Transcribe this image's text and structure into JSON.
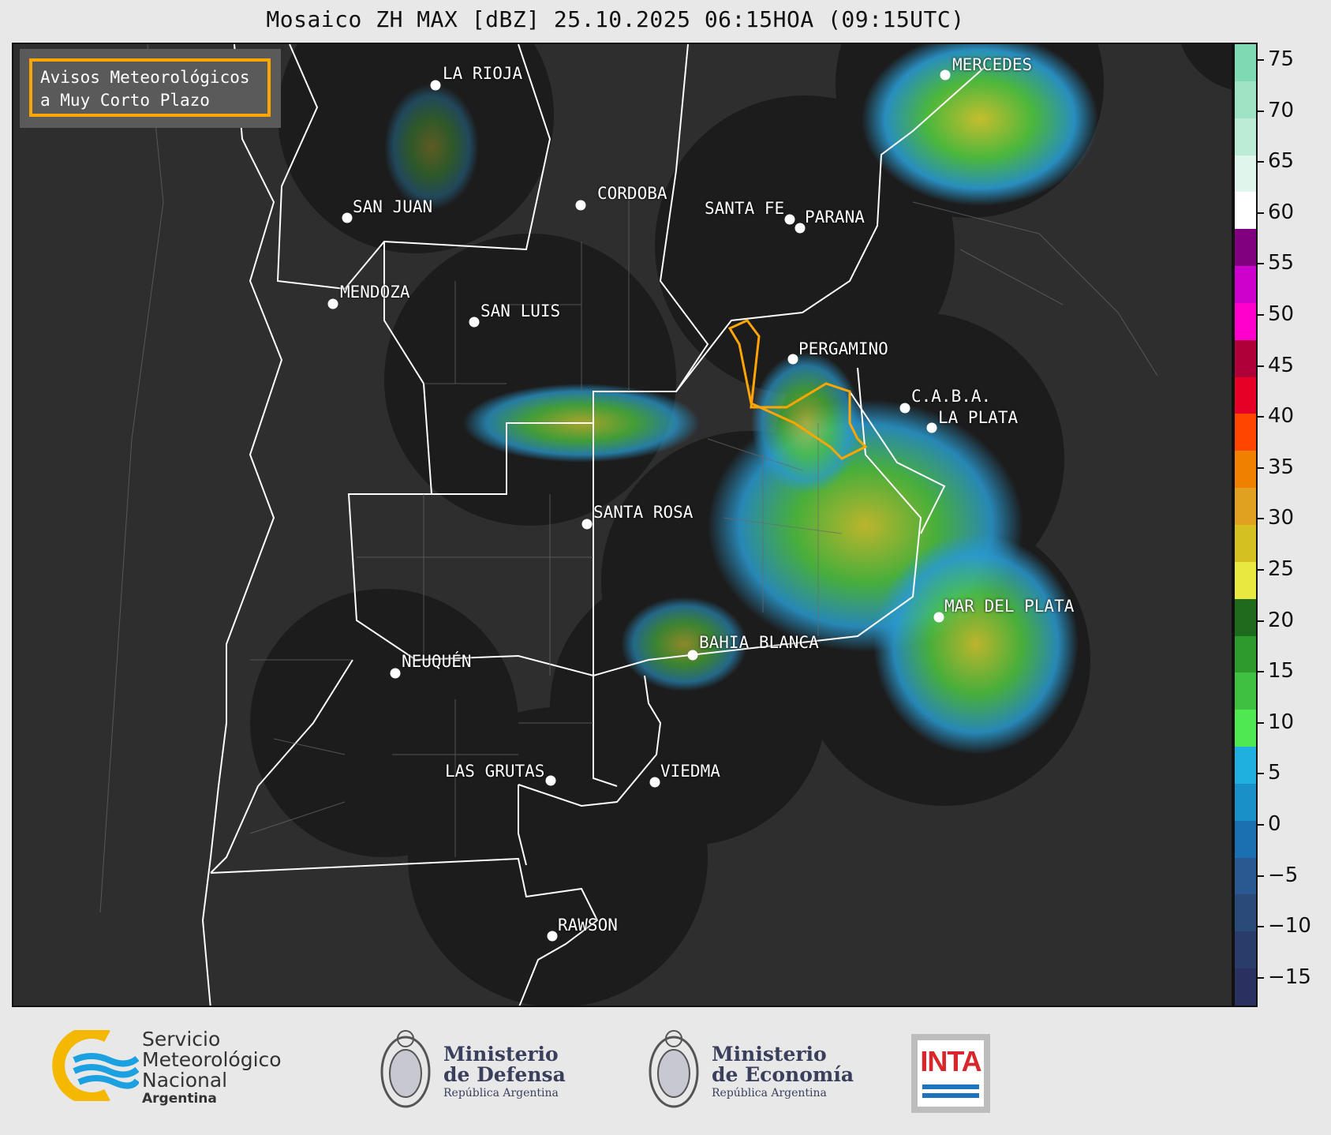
{
  "title": "Mosaico ZH MAX [dBZ] 25.10.2025 06:15HOA (09:15UTC)",
  "warning": {
    "line1": "Avisos Meteorológicos",
    "line2": "a Muy Corto Plazo"
  },
  "cities": [
    "LA RIOJA",
    "SAN JUAN",
    "CORDOBA",
    "SANTA FE",
    "PARANA",
    "MERCEDES",
    "MENDOZA",
    "SAN LUIS",
    "PERGAMINO",
    "C.A.B.A.",
    "LA PLATA",
    "SANTA ROSA",
    "MAR DEL PLATA",
    "BAHIA BLANCA",
    "NEUQUÉN",
    "LAS GRUTAS",
    "VIEDMA",
    "RAWSON"
  ],
  "colorbar": {
    "ticks": [
      "75",
      "70",
      "65",
      "60",
      "55",
      "50",
      "45",
      "40",
      "35",
      "30",
      "25",
      "20",
      "15",
      "10",
      "5",
      "0",
      "−5",
      "−10",
      "−15"
    ],
    "colors": [
      "#7fd9b3",
      "#9ee3c4",
      "#bcebd6",
      "#e0f5ec",
      "#ffffff",
      "#800080",
      "#cc00cc",
      "#ff00cc",
      "#b0003a",
      "#e60026",
      "#ff4500",
      "#f08000",
      "#e0a020",
      "#d4c020",
      "#e8e840",
      "#1e6b1e",
      "#2e9a2e",
      "#40c040",
      "#50e850",
      "#20b0e0",
      "#1a90c8",
      "#1a70b0",
      "#2a5890",
      "#2a4a7a",
      "#2a3c6a",
      "#2a3060"
    ]
  },
  "footer": {
    "smn": {
      "line1": "Servicio",
      "line2": "Meteorológico",
      "line3": "Nacional",
      "line4": "Argentina"
    },
    "defensa": {
      "line1": "Ministerio",
      "line2": "de Defensa",
      "line3": "República Argentina"
    },
    "economia": {
      "line1": "Ministerio",
      "line2": "de Economía",
      "line3": "República Argentina"
    },
    "inta": "INTA"
  }
}
